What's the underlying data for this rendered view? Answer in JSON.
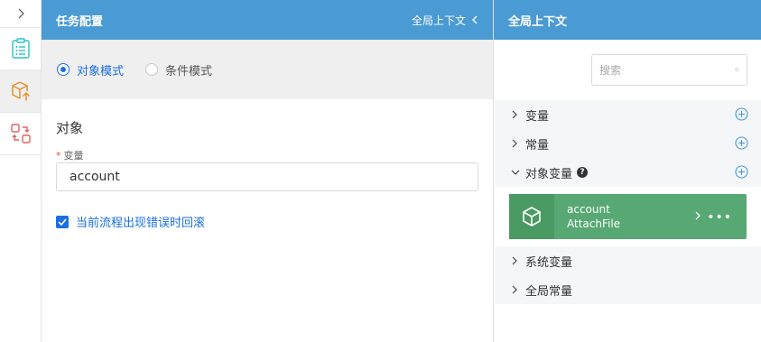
{
  "rail": {
    "collapse_icon": "chevron-right-icon",
    "buttons": [
      {
        "icon": "clipboard-list-icon",
        "color": "#2cc0c8"
      },
      {
        "icon": "box-upload-icon",
        "color": "#e29233",
        "active": true
      },
      {
        "icon": "swap-icon",
        "color": "#e06060"
      }
    ]
  },
  "middle": {
    "title": "任务配置",
    "context_link": "全局上下文",
    "modes": [
      {
        "label": "对象模式",
        "checked": true
      },
      {
        "label": "条件模式",
        "checked": false
      }
    ],
    "section_title": "对象",
    "field": {
      "required_mark": "*",
      "label": "变量",
      "value": "account"
    },
    "rollback_checkbox": {
      "label": "当前流程出现错误时回滚",
      "checked": true
    }
  },
  "right": {
    "title": "全局上下文",
    "search": {
      "placeholder": "搜索",
      "value": ""
    },
    "tree": [
      {
        "label": "变量",
        "expanded": false,
        "addable": true
      },
      {
        "label": "常量",
        "expanded": false,
        "addable": true
      },
      {
        "label": "对象变量",
        "expanded": true,
        "addable": true,
        "help": "?"
      },
      {
        "label": "系统变量",
        "expanded": false,
        "addable": false
      },
      {
        "label": "全局常量",
        "expanded": false,
        "addable": false
      }
    ],
    "object_card": {
      "name": "account",
      "type": "AttachFile",
      "more": "•••"
    }
  },
  "colors": {
    "header": "#4a9ad4",
    "accent": "#1b6fe0",
    "card_green": "#57a872",
    "add_icon": "#4a9ad4"
  }
}
